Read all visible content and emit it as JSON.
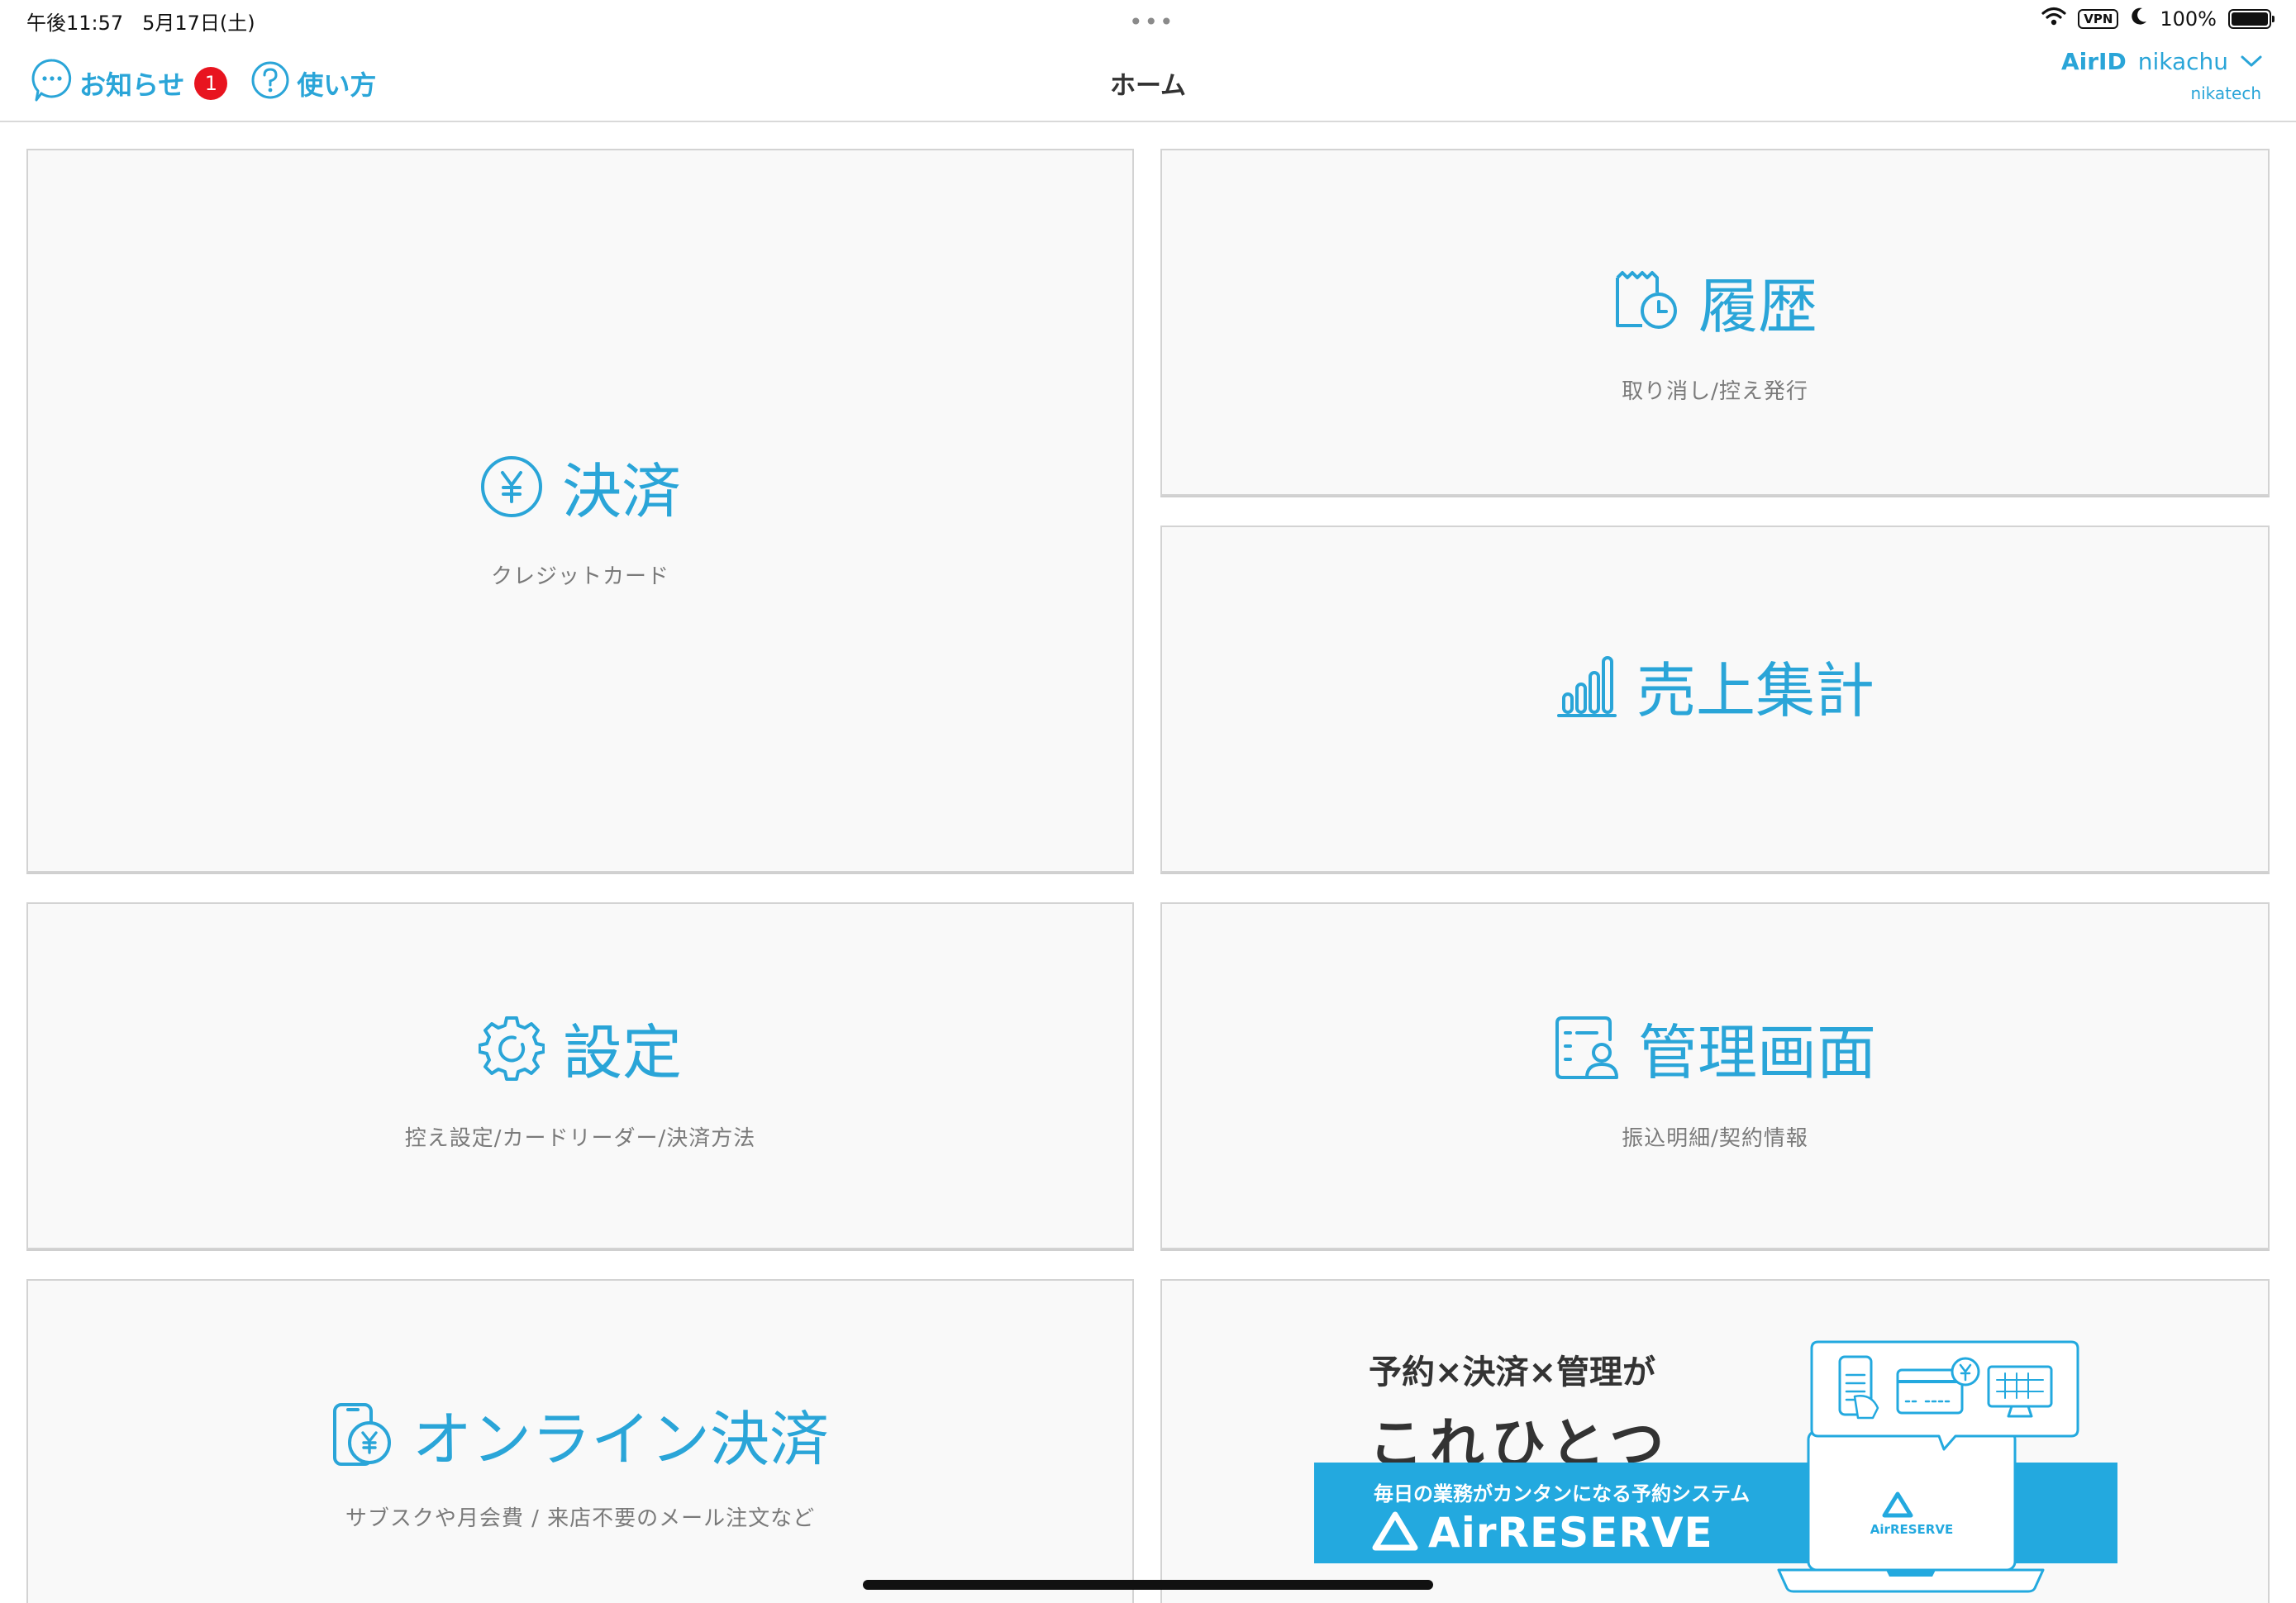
{
  "status_bar": {
    "time": "午後11:57",
    "date": "5月17日(土)",
    "vpn": "VPN",
    "battery": "100%",
    "battery_level": 1.0
  },
  "nav": {
    "notifications_label": "お知らせ",
    "notifications_count": "1",
    "help_label": "使い方",
    "title": "ホーム",
    "airid_label": "AirID",
    "account_name": "nikachu",
    "account_sub": "nikatech"
  },
  "tiles": {
    "payment": {
      "title": "決済",
      "subtitle": "クレジットカード",
      "icon": "yen-coin-icon"
    },
    "history": {
      "title": "履歴",
      "subtitle": "取り消し/控え発行",
      "icon": "receipt-clock-icon"
    },
    "sales": {
      "title": "売上集計",
      "subtitle": "",
      "icon": "bar-chart-icon"
    },
    "settings": {
      "title": "設定",
      "subtitle": "控え設定/カードリーダー/決済方法",
      "icon": "gear-icon"
    },
    "admin": {
      "title": "管理画面",
      "subtitle": "振込明細/契約情報",
      "icon": "admin-profile-icon"
    },
    "online_payment": {
      "title": "オンライン決済",
      "subtitle": "サブスクや月会費 / 来店不要のメール注文など",
      "icon": "phone-yen-icon"
    }
  },
  "ad": {
    "headline1": "予約×決済×管理が",
    "headline2": "これひとつ",
    "tagline": "毎日の業務がカンタンになる予約システム",
    "brand": "AirRESERVE",
    "laptop_brand": "AirRESERVE"
  },
  "colors": {
    "accent": "#2aa5d8",
    "badge": "#e8141f",
    "tile_bg": "#f9f9f9",
    "ad_blue": "#23a9df"
  }
}
